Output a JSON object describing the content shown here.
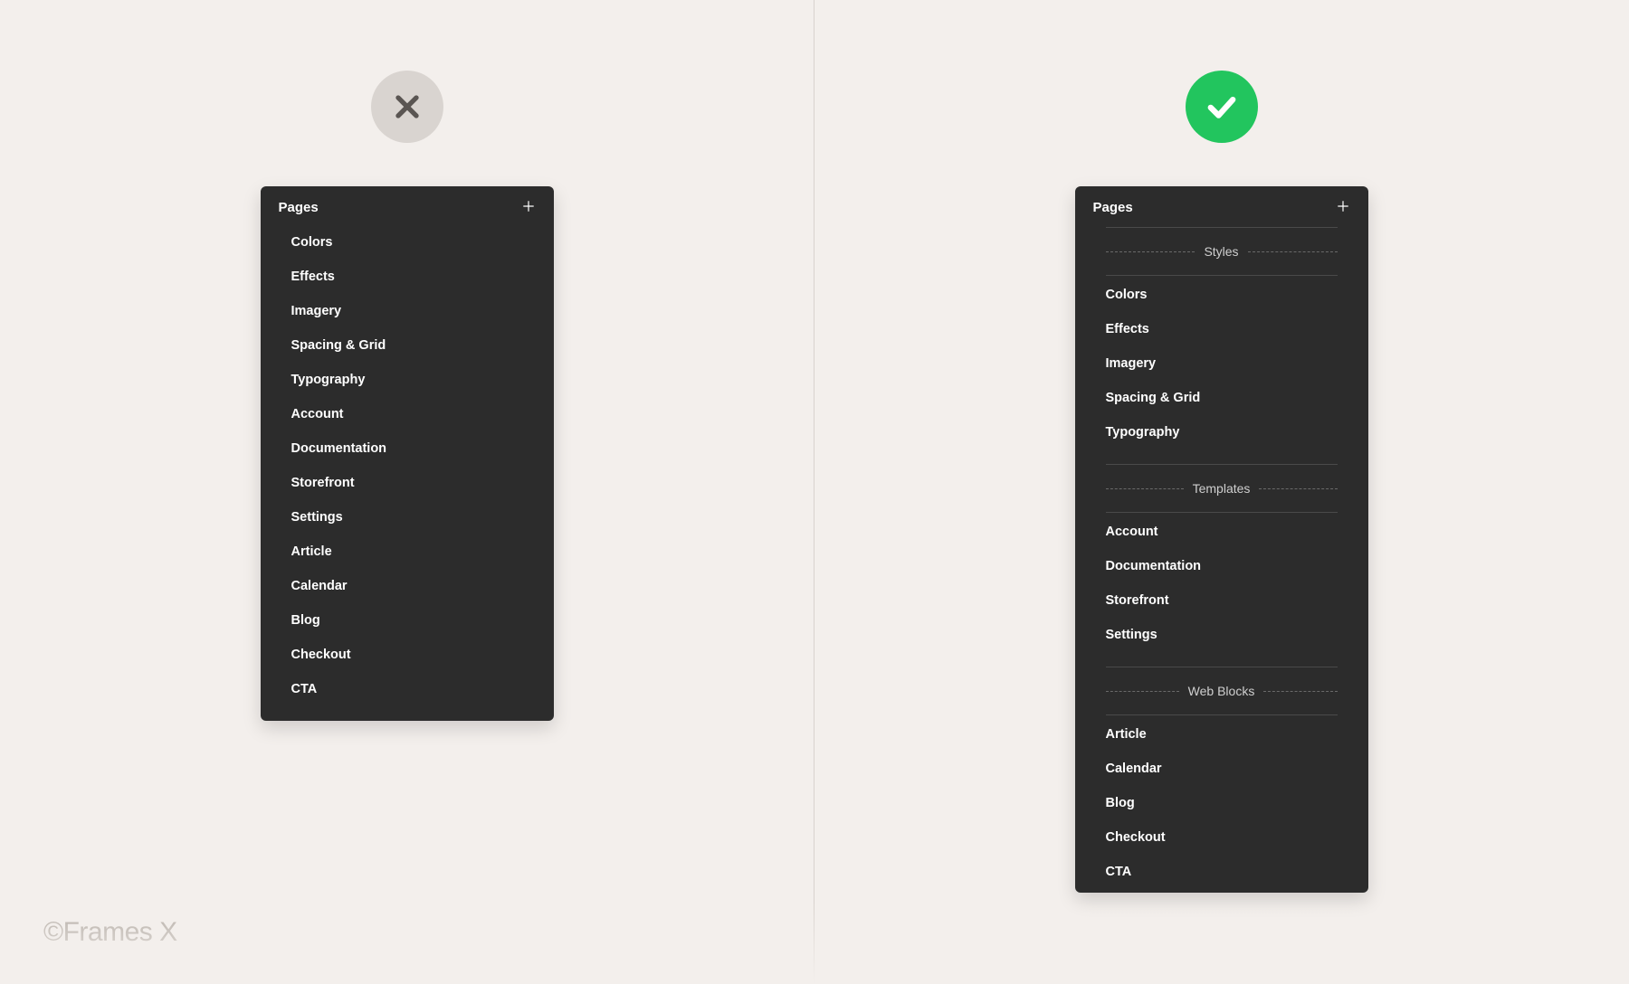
{
  "copyright": "©Frames X",
  "left_panel": {
    "title": "Pages",
    "items": [
      "Colors",
      "Effects",
      "Imagery",
      "Spacing & Grid",
      "Typography",
      "Account",
      "Documentation",
      "Storefront",
      "Settings",
      "Article",
      "Calendar",
      "Blog",
      "Checkout",
      "CTA"
    ]
  },
  "right_panel": {
    "title": "Pages",
    "sections": [
      {
        "label": "Styles",
        "items": [
          "Colors",
          "Effects",
          "Imagery",
          "Spacing & Grid",
          "Typography"
        ]
      },
      {
        "label": "Templates",
        "items": [
          "Account",
          "Documentation",
          "Storefront",
          "Settings"
        ]
      },
      {
        "label": "Web Blocks",
        "items": [
          "Article",
          "Calendar",
          "Blog",
          "Checkout",
          "CTA"
        ]
      }
    ]
  },
  "colors": {
    "background": "#f3efec",
    "panel": "#2c2c2c",
    "badge_x": "#d9d4d0",
    "badge_check": "#22c55e",
    "x_icon": "#5a5552",
    "check_icon": "#ffffff"
  }
}
